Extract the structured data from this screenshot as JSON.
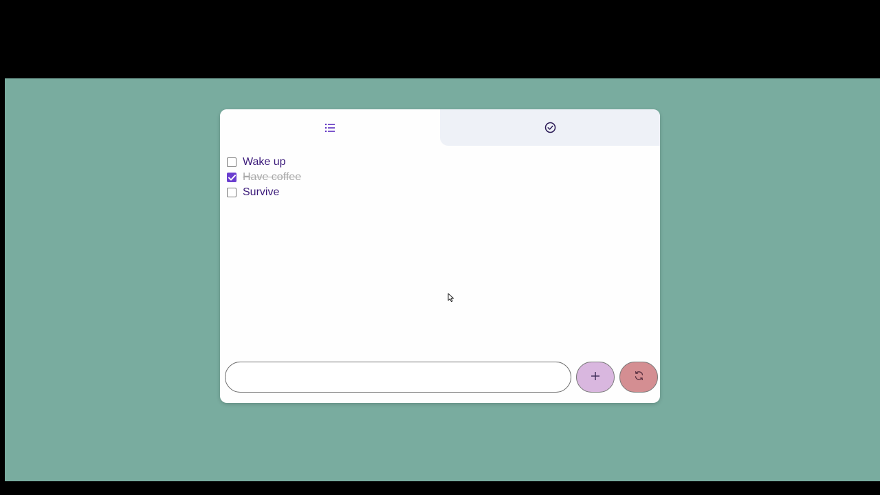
{
  "tabs": [
    {
      "icon": "list-icon",
      "active": true
    },
    {
      "icon": "check-circle-icon",
      "active": false
    }
  ],
  "todos": [
    {
      "label": "Wake up",
      "done": false
    },
    {
      "label": "Have coffee",
      "done": true
    },
    {
      "label": "Survive",
      "done": false
    }
  ],
  "input": {
    "value": "",
    "placeholder": ""
  },
  "buttons": {
    "add_icon": "plus-icon",
    "reset_icon": "refresh-icon"
  },
  "colors": {
    "background": "#79ac9f",
    "accent": "#6a3ecf",
    "text": "#3b1a7a",
    "add_button": "#d9b7df",
    "reset_button": "#d48e92"
  }
}
